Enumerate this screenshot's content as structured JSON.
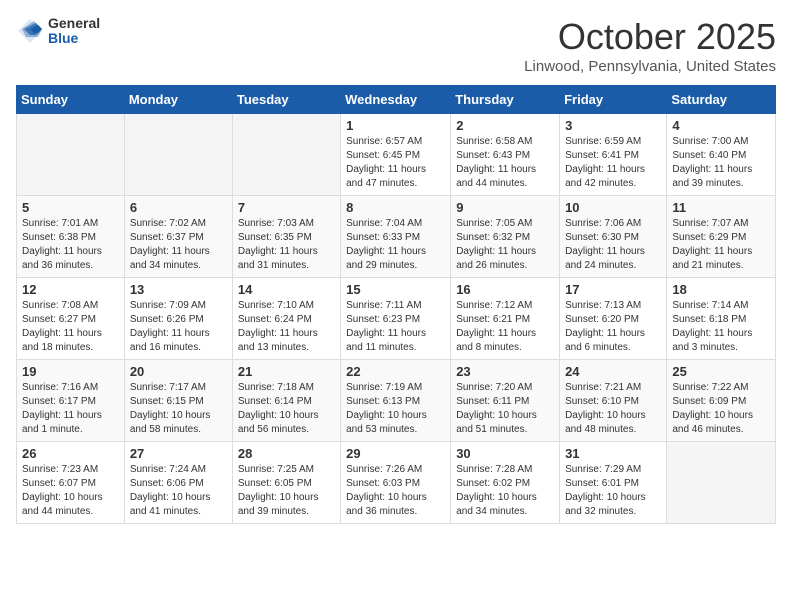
{
  "logo": {
    "general": "General",
    "blue": "Blue"
  },
  "title": "October 2025",
  "location": "Linwood, Pennsylvania, United States",
  "days_header": [
    "Sunday",
    "Monday",
    "Tuesday",
    "Wednesday",
    "Thursday",
    "Friday",
    "Saturday"
  ],
  "weeks": [
    [
      {
        "day": "",
        "info": ""
      },
      {
        "day": "",
        "info": ""
      },
      {
        "day": "",
        "info": ""
      },
      {
        "day": "1",
        "info": "Sunrise: 6:57 AM\nSunset: 6:45 PM\nDaylight: 11 hours and 47 minutes."
      },
      {
        "day": "2",
        "info": "Sunrise: 6:58 AM\nSunset: 6:43 PM\nDaylight: 11 hours and 44 minutes."
      },
      {
        "day": "3",
        "info": "Sunrise: 6:59 AM\nSunset: 6:41 PM\nDaylight: 11 hours and 42 minutes."
      },
      {
        "day": "4",
        "info": "Sunrise: 7:00 AM\nSunset: 6:40 PM\nDaylight: 11 hours and 39 minutes."
      }
    ],
    [
      {
        "day": "5",
        "info": "Sunrise: 7:01 AM\nSunset: 6:38 PM\nDaylight: 11 hours and 36 minutes."
      },
      {
        "day": "6",
        "info": "Sunrise: 7:02 AM\nSunset: 6:37 PM\nDaylight: 11 hours and 34 minutes."
      },
      {
        "day": "7",
        "info": "Sunrise: 7:03 AM\nSunset: 6:35 PM\nDaylight: 11 hours and 31 minutes."
      },
      {
        "day": "8",
        "info": "Sunrise: 7:04 AM\nSunset: 6:33 PM\nDaylight: 11 hours and 29 minutes."
      },
      {
        "day": "9",
        "info": "Sunrise: 7:05 AM\nSunset: 6:32 PM\nDaylight: 11 hours and 26 minutes."
      },
      {
        "day": "10",
        "info": "Sunrise: 7:06 AM\nSunset: 6:30 PM\nDaylight: 11 hours and 24 minutes."
      },
      {
        "day": "11",
        "info": "Sunrise: 7:07 AM\nSunset: 6:29 PM\nDaylight: 11 hours and 21 minutes."
      }
    ],
    [
      {
        "day": "12",
        "info": "Sunrise: 7:08 AM\nSunset: 6:27 PM\nDaylight: 11 hours and 18 minutes."
      },
      {
        "day": "13",
        "info": "Sunrise: 7:09 AM\nSunset: 6:26 PM\nDaylight: 11 hours and 16 minutes."
      },
      {
        "day": "14",
        "info": "Sunrise: 7:10 AM\nSunset: 6:24 PM\nDaylight: 11 hours and 13 minutes."
      },
      {
        "day": "15",
        "info": "Sunrise: 7:11 AM\nSunset: 6:23 PM\nDaylight: 11 hours and 11 minutes."
      },
      {
        "day": "16",
        "info": "Sunrise: 7:12 AM\nSunset: 6:21 PM\nDaylight: 11 hours and 8 minutes."
      },
      {
        "day": "17",
        "info": "Sunrise: 7:13 AM\nSunset: 6:20 PM\nDaylight: 11 hours and 6 minutes."
      },
      {
        "day": "18",
        "info": "Sunrise: 7:14 AM\nSunset: 6:18 PM\nDaylight: 11 hours and 3 minutes."
      }
    ],
    [
      {
        "day": "19",
        "info": "Sunrise: 7:16 AM\nSunset: 6:17 PM\nDaylight: 11 hours and 1 minute."
      },
      {
        "day": "20",
        "info": "Sunrise: 7:17 AM\nSunset: 6:15 PM\nDaylight: 10 hours and 58 minutes."
      },
      {
        "day": "21",
        "info": "Sunrise: 7:18 AM\nSunset: 6:14 PM\nDaylight: 10 hours and 56 minutes."
      },
      {
        "day": "22",
        "info": "Sunrise: 7:19 AM\nSunset: 6:13 PM\nDaylight: 10 hours and 53 minutes."
      },
      {
        "day": "23",
        "info": "Sunrise: 7:20 AM\nSunset: 6:11 PM\nDaylight: 10 hours and 51 minutes."
      },
      {
        "day": "24",
        "info": "Sunrise: 7:21 AM\nSunset: 6:10 PM\nDaylight: 10 hours and 48 minutes."
      },
      {
        "day": "25",
        "info": "Sunrise: 7:22 AM\nSunset: 6:09 PM\nDaylight: 10 hours and 46 minutes."
      }
    ],
    [
      {
        "day": "26",
        "info": "Sunrise: 7:23 AM\nSunset: 6:07 PM\nDaylight: 10 hours and 44 minutes."
      },
      {
        "day": "27",
        "info": "Sunrise: 7:24 AM\nSunset: 6:06 PM\nDaylight: 10 hours and 41 minutes."
      },
      {
        "day": "28",
        "info": "Sunrise: 7:25 AM\nSunset: 6:05 PM\nDaylight: 10 hours and 39 minutes."
      },
      {
        "day": "29",
        "info": "Sunrise: 7:26 AM\nSunset: 6:03 PM\nDaylight: 10 hours and 36 minutes."
      },
      {
        "day": "30",
        "info": "Sunrise: 7:28 AM\nSunset: 6:02 PM\nDaylight: 10 hours and 34 minutes."
      },
      {
        "day": "31",
        "info": "Sunrise: 7:29 AM\nSunset: 6:01 PM\nDaylight: 10 hours and 32 minutes."
      },
      {
        "day": "",
        "info": ""
      }
    ]
  ]
}
